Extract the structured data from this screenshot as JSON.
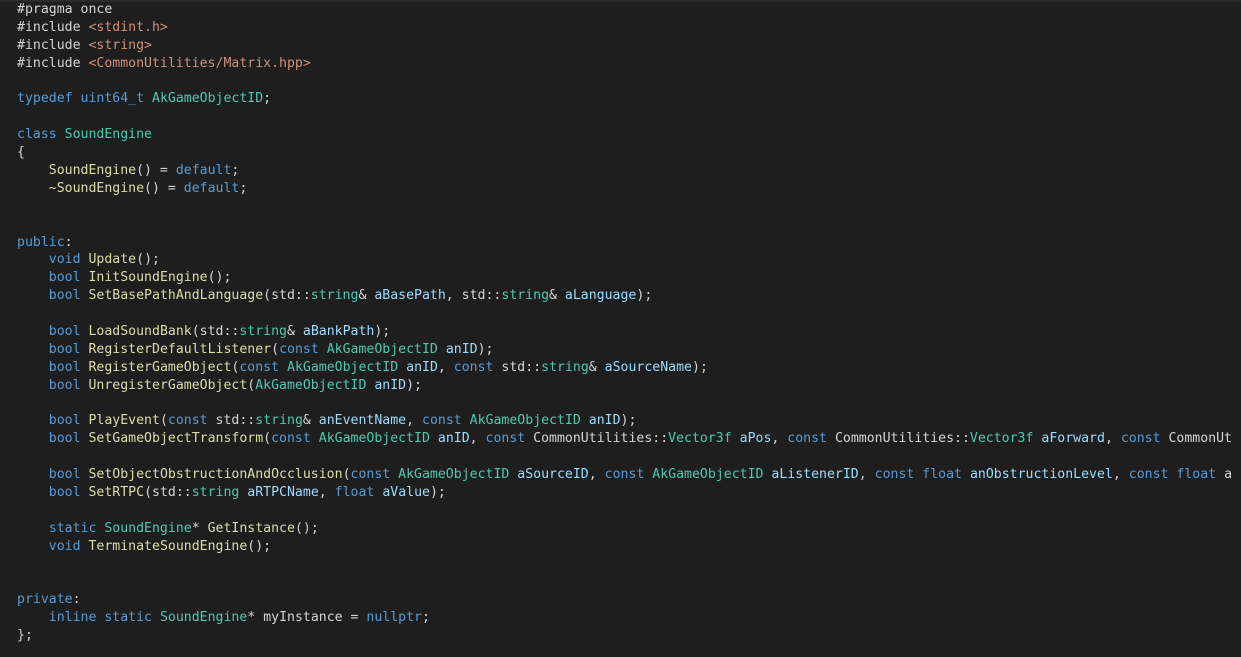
{
  "editor": {
    "language": "cpp",
    "colors": {
      "background": "#1e1e1e",
      "plain": "#d4d4d4",
      "keyword": "#569cd6",
      "type": "#4ec9b0",
      "function": "#dcdcaa",
      "parameter": "#9cdcfe",
      "string": "#ce9178"
    },
    "lines": [
      [
        [
          "plain",
          "#pragma once"
        ]
      ],
      [
        [
          "plain",
          "#include "
        ],
        [
          "string",
          "<stdint.h>"
        ]
      ],
      [
        [
          "plain",
          "#include "
        ],
        [
          "string",
          "<string>"
        ]
      ],
      [
        [
          "plain",
          "#include "
        ],
        [
          "string",
          "<CommonUtilities/Matrix.hpp>"
        ]
      ],
      [],
      [
        [
          "keyword",
          "typedef"
        ],
        [
          "plain",
          " "
        ],
        [
          "keyword",
          "uint64_t"
        ],
        [
          "plain",
          " "
        ],
        [
          "type",
          "AkGameObjectID"
        ],
        [
          "plain",
          ";"
        ]
      ],
      [],
      [
        [
          "keyword",
          "class"
        ],
        [
          "plain",
          " "
        ],
        [
          "type",
          "SoundEngine"
        ]
      ],
      [
        [
          "plain",
          "{"
        ]
      ],
      [
        [
          "plain",
          "    "
        ],
        [
          "func",
          "SoundEngine"
        ],
        [
          "plain",
          "() = "
        ],
        [
          "keyword",
          "default"
        ],
        [
          "plain",
          ";"
        ]
      ],
      [
        [
          "plain",
          "    "
        ],
        [
          "func",
          "~SoundEngine"
        ],
        [
          "plain",
          "() = "
        ],
        [
          "keyword",
          "default"
        ],
        [
          "plain",
          ";"
        ]
      ],
      [],
      [],
      [
        [
          "keyword",
          "public"
        ],
        [
          "plain",
          ":"
        ]
      ],
      [
        [
          "plain",
          "    "
        ],
        [
          "keyword",
          "void"
        ],
        [
          "plain",
          " "
        ],
        [
          "func",
          "Update"
        ],
        [
          "plain",
          "();"
        ]
      ],
      [
        [
          "plain",
          "    "
        ],
        [
          "keyword",
          "bool"
        ],
        [
          "plain",
          " "
        ],
        [
          "func",
          "InitSoundEngine"
        ],
        [
          "plain",
          "();"
        ]
      ],
      [
        [
          "plain",
          "    "
        ],
        [
          "keyword",
          "bool"
        ],
        [
          "plain",
          " "
        ],
        [
          "func",
          "SetBasePathAndLanguage"
        ],
        [
          "plain",
          "(std::"
        ],
        [
          "type",
          "string"
        ],
        [
          "plain",
          "& "
        ],
        [
          "param",
          "aBasePath"
        ],
        [
          "plain",
          ", std::"
        ],
        [
          "type",
          "string"
        ],
        [
          "plain",
          "& "
        ],
        [
          "param",
          "aLanguage"
        ],
        [
          "plain",
          ");"
        ]
      ],
      [],
      [
        [
          "plain",
          "    "
        ],
        [
          "keyword",
          "bool"
        ],
        [
          "plain",
          " "
        ],
        [
          "func",
          "LoadSoundBank"
        ],
        [
          "plain",
          "(std::"
        ],
        [
          "type",
          "string"
        ],
        [
          "plain",
          "& "
        ],
        [
          "param",
          "aBankPath"
        ],
        [
          "plain",
          ");"
        ]
      ],
      [
        [
          "plain",
          "    "
        ],
        [
          "keyword",
          "bool"
        ],
        [
          "plain",
          " "
        ],
        [
          "func",
          "RegisterDefaultListener"
        ],
        [
          "plain",
          "("
        ],
        [
          "keyword",
          "const"
        ],
        [
          "plain",
          " "
        ],
        [
          "type",
          "AkGameObjectID"
        ],
        [
          "plain",
          " "
        ],
        [
          "param",
          "anID"
        ],
        [
          "plain",
          ");"
        ]
      ],
      [
        [
          "plain",
          "    "
        ],
        [
          "keyword",
          "bool"
        ],
        [
          "plain",
          " "
        ],
        [
          "func",
          "RegisterGameObject"
        ],
        [
          "plain",
          "("
        ],
        [
          "keyword",
          "const"
        ],
        [
          "plain",
          " "
        ],
        [
          "type",
          "AkGameObjectID"
        ],
        [
          "plain",
          " "
        ],
        [
          "param",
          "anID"
        ],
        [
          "plain",
          ", "
        ],
        [
          "keyword",
          "const"
        ],
        [
          "plain",
          " std::"
        ],
        [
          "type",
          "string"
        ],
        [
          "plain",
          "& "
        ],
        [
          "param",
          "aSourceName"
        ],
        [
          "plain",
          ");"
        ]
      ],
      [
        [
          "plain",
          "    "
        ],
        [
          "keyword",
          "bool"
        ],
        [
          "plain",
          " "
        ],
        [
          "func",
          "UnregisterGameObject"
        ],
        [
          "plain",
          "("
        ],
        [
          "type",
          "AkGameObjectID"
        ],
        [
          "plain",
          " "
        ],
        [
          "param",
          "anID"
        ],
        [
          "plain",
          ");"
        ]
      ],
      [],
      [
        [
          "plain",
          "    "
        ],
        [
          "keyword",
          "bool"
        ],
        [
          "plain",
          " "
        ],
        [
          "func",
          "PlayEvent"
        ],
        [
          "plain",
          "("
        ],
        [
          "keyword",
          "const"
        ],
        [
          "plain",
          " std::"
        ],
        [
          "type",
          "string"
        ],
        [
          "plain",
          "& "
        ],
        [
          "param",
          "anEventName"
        ],
        [
          "plain",
          ", "
        ],
        [
          "keyword",
          "const"
        ],
        [
          "plain",
          " "
        ],
        [
          "type",
          "AkGameObjectID"
        ],
        [
          "plain",
          " "
        ],
        [
          "param",
          "anID"
        ],
        [
          "plain",
          ");"
        ]
      ],
      [
        [
          "plain",
          "    "
        ],
        [
          "keyword",
          "bool"
        ],
        [
          "plain",
          " "
        ],
        [
          "func",
          "SetGameObjectTransform"
        ],
        [
          "plain",
          "("
        ],
        [
          "keyword",
          "const"
        ],
        [
          "plain",
          " "
        ],
        [
          "type",
          "AkGameObjectID"
        ],
        [
          "plain",
          " "
        ],
        [
          "param",
          "anID"
        ],
        [
          "plain",
          ", "
        ],
        [
          "keyword",
          "const"
        ],
        [
          "plain",
          " CommonUtilities::"
        ],
        [
          "type",
          "Vector3f"
        ],
        [
          "plain",
          " "
        ],
        [
          "param",
          "aPos"
        ],
        [
          "plain",
          ", "
        ],
        [
          "keyword",
          "const"
        ],
        [
          "plain",
          " CommonUtilities::"
        ],
        [
          "type",
          "Vector3f"
        ],
        [
          "plain",
          " "
        ],
        [
          "param",
          "aForward"
        ],
        [
          "plain",
          ", "
        ],
        [
          "keyword",
          "const"
        ],
        [
          "plain",
          " CommonUt"
        ]
      ],
      [],
      [
        [
          "plain",
          "    "
        ],
        [
          "keyword",
          "bool"
        ],
        [
          "plain",
          " "
        ],
        [
          "func",
          "SetObjectObstructionAndOcclusion"
        ],
        [
          "plain",
          "("
        ],
        [
          "keyword",
          "const"
        ],
        [
          "plain",
          " "
        ],
        [
          "type",
          "AkGameObjectID"
        ],
        [
          "plain",
          " "
        ],
        [
          "param",
          "aSourceID"
        ],
        [
          "plain",
          ", "
        ],
        [
          "keyword",
          "const"
        ],
        [
          "plain",
          " "
        ],
        [
          "type",
          "AkGameObjectID"
        ],
        [
          "plain",
          " "
        ],
        [
          "param",
          "aListenerID"
        ],
        [
          "plain",
          ", "
        ],
        [
          "keyword",
          "const"
        ],
        [
          "plain",
          " "
        ],
        [
          "keyword",
          "float"
        ],
        [
          "plain",
          " "
        ],
        [
          "param",
          "anObstructionLevel"
        ],
        [
          "plain",
          ", "
        ],
        [
          "keyword",
          "const"
        ],
        [
          "plain",
          " "
        ],
        [
          "keyword",
          "float"
        ],
        [
          "plain",
          " a"
        ]
      ],
      [
        [
          "plain",
          "    "
        ],
        [
          "keyword",
          "bool"
        ],
        [
          "plain",
          " "
        ],
        [
          "func",
          "SetRTPC"
        ],
        [
          "plain",
          "(std::"
        ],
        [
          "type",
          "string"
        ],
        [
          "plain",
          " "
        ],
        [
          "param",
          "aRTPCName"
        ],
        [
          "plain",
          ", "
        ],
        [
          "keyword",
          "float"
        ],
        [
          "plain",
          " "
        ],
        [
          "param",
          "aValue"
        ],
        [
          "plain",
          ");"
        ]
      ],
      [],
      [
        [
          "plain",
          "    "
        ],
        [
          "keyword",
          "static"
        ],
        [
          "plain",
          " "
        ],
        [
          "type",
          "SoundEngine"
        ],
        [
          "plain",
          "* "
        ],
        [
          "func",
          "GetInstance"
        ],
        [
          "plain",
          "();"
        ]
      ],
      [
        [
          "plain",
          "    "
        ],
        [
          "keyword",
          "void"
        ],
        [
          "plain",
          " "
        ],
        [
          "func",
          "TerminateSoundEngine"
        ],
        [
          "plain",
          "();"
        ]
      ],
      [],
      [],
      [
        [
          "keyword",
          "private"
        ],
        [
          "plain",
          ":"
        ]
      ],
      [
        [
          "plain",
          "    "
        ],
        [
          "keyword",
          "inline"
        ],
        [
          "plain",
          " "
        ],
        [
          "keyword",
          "static"
        ],
        [
          "plain",
          " "
        ],
        [
          "type",
          "SoundEngine"
        ],
        [
          "plain",
          "* "
        ],
        [
          "plain",
          "myInstance = "
        ],
        [
          "keyword",
          "nullptr"
        ],
        [
          "plain",
          ";"
        ]
      ],
      [
        [
          "plain",
          "};"
        ]
      ]
    ]
  }
}
